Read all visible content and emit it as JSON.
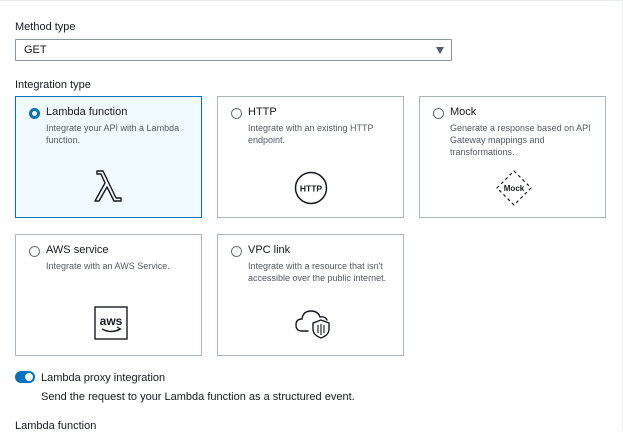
{
  "method_type": {
    "label": "Method type",
    "value": "GET"
  },
  "integration_type": {
    "label": "Integration type",
    "options": [
      {
        "title": "Lambda function",
        "description": "Integrate your API with a Lambda function.",
        "icon": "lambda-icon",
        "selected": true
      },
      {
        "title": "HTTP",
        "description": "Integrate with an existing HTTP endpoint.",
        "icon": "http-icon",
        "icon_text": "HTTP",
        "selected": false
      },
      {
        "title": "Mock",
        "description": "Generate a response based on API Gateway mappings and transformations.",
        "icon": "mock-icon",
        "icon_text": "Mock",
        "selected": false
      },
      {
        "title": "AWS service",
        "description": "Integrate with an AWS Service.",
        "icon": "aws-icon",
        "icon_text": "aws",
        "selected": false
      },
      {
        "title": "VPC link",
        "description": "Integrate with a resource that isn't accessible over the public internet.",
        "icon": "vpc-cloud-shield-icon",
        "selected": false
      }
    ]
  },
  "lambda_proxy": {
    "label": "Lambda proxy integration",
    "description": "Send the request to your Lambda function as a structured event.",
    "enabled": true
  },
  "lambda_function_label": "Lambda function",
  "colors": {
    "accent": "#0073bb",
    "selected_bg": "#f1faff",
    "border": "#aab7b8",
    "text": "#16191f",
    "muted": "#545b64"
  }
}
